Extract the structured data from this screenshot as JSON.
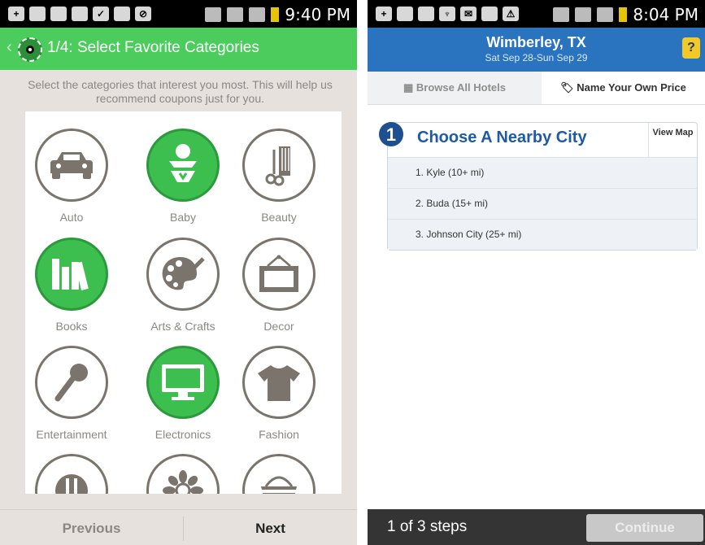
{
  "left_phone": {
    "status_time": "9:40 PM",
    "app_title": "1/4: Select Favorite Categories",
    "intro_text": "Select the categories that interest you most. This will help us recommend coupons just for you.",
    "categories": [
      {
        "label": "Auto",
        "icon": "car-icon",
        "selected": false
      },
      {
        "label": "Baby",
        "icon": "baby-icon",
        "selected": true
      },
      {
        "label": "Beauty",
        "icon": "comb-scissors-icon",
        "selected": false
      },
      {
        "label": "Books",
        "icon": "books-icon",
        "selected": true
      },
      {
        "label": "Arts & Crafts",
        "icon": "palette-icon",
        "selected": false
      },
      {
        "label": "Decor",
        "icon": "picture-frame-icon",
        "selected": false
      },
      {
        "label": "Entertainment",
        "icon": "microphone-icon",
        "selected": false
      },
      {
        "label": "Electronics",
        "icon": "monitor-icon",
        "selected": true
      },
      {
        "label": "Fashion",
        "icon": "tshirt-icon",
        "selected": false
      },
      {
        "label": "",
        "icon": "dining-icon",
        "selected": false
      },
      {
        "label": "",
        "icon": "flower-icon",
        "selected": false
      },
      {
        "label": "",
        "icon": "basket-icon",
        "selected": false
      }
    ],
    "prev_label": "Previous",
    "next_label": "Next"
  },
  "right_phone": {
    "status_time": "8:04 PM",
    "city": "Wimberley, TX",
    "dates": "Sat Sep 28-Sun Sep 29",
    "help_label": "?",
    "tab_browse": "Browse All Hotels",
    "tab_nyop": "Name Your Own Price",
    "step_number": "1",
    "choose_title": "Choose A Nearby City",
    "view_map": "View Map",
    "cities": [
      "1. Kyle (10+ mi)",
      "2. Buda (15+ mi)",
      "3. Johnson City (25+ mi)"
    ],
    "steps_label": "1 of 3 steps",
    "continue_label": "Continue"
  },
  "colors": {
    "brand_green": "#4ccc5c",
    "selected_green": "#3dbf4f",
    "header_blue": "#2a74bf",
    "title_blue": "#1f5aa5",
    "help_yellow": "#f3c928"
  }
}
